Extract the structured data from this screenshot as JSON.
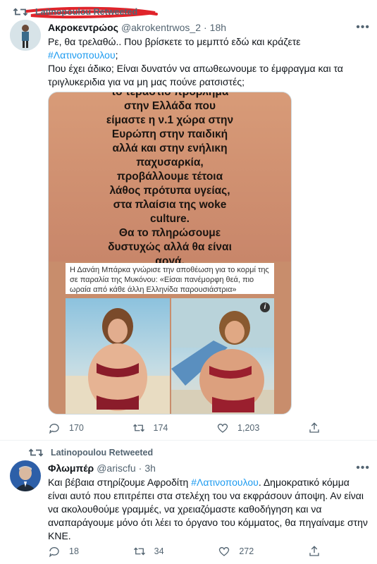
{
  "tweet1": {
    "retweeted_by": "Latinopoulou Retweeted",
    "author_name": "Ακροκεντρώος",
    "author_handle": "@akrokentrwos_2",
    "separator": "·",
    "time": "18h",
    "text_before_tag": "Ρε, θα τρελαθώ.. Που βρίσκετε το μεμπτό εδώ και κράζετε ",
    "hashtag": "#Λατινοπουλου",
    "text_after_tag": ";",
    "text_line2": "Που έχει άδικο; Είναι δυνατόν να απωθεωνουμε το έμφραγμα και τα τριγλυκεριδια για να μη μας πούνε ρατσιστές;",
    "media": {
      "overlay_text": "το τεράστιο πρόβλημα\nστην Ελλάδα που\nείμαστε η ν.1 χώρα στην\nΕυρώπη στην παιδική\nαλλά και στην ενήλικη\nπαχυσαρκία,\nπροβάλλουμε τέτοια\nλάθος πρότυπα υγείας,\nστα πλαίσια της woke\nculture.\nΘα το πληρώσουμε\nδυστυχώς αλλά θα είναι\nαργά.",
      "caption": "Η Δανάη Μπάρκα γνώρισε την αποθέωση για το κορμί της σε παραλία της Μυκόνου: «Είσαι πανέμορφη θεά, πιο ωραία από κάθε άλλη Ελληνίδα παρουσιάστρια»",
      "info_icon": "i"
    },
    "replies": "170",
    "retweets": "174",
    "likes": "1,203"
  },
  "tweet2": {
    "retweeted_by": "Latinopoulou Retweeted",
    "author_name": "Φλωμπέρ",
    "author_handle": "@ariscfu",
    "separator": "·",
    "time": "3h",
    "text_before_tag": "Και βέβαια στηρίζουμε Αφροδίτη ",
    "hashtag": "#Λατινοπουλου",
    "text_after_tag": ". Δημοκρατικό κόμμα είναι αυτό που επιτρέπει στα στελέχη του να εκφράσουν άποψη. Αν είναι να ακολουθούμε γραμμές, να χρειαζόμαστε καθοδήγηση και να αναπαράγουμε μόνο ότι λέει το όργανο του κόμματος, θα πηγαίναμε στην ΚΝΕ.",
    "replies": "18",
    "retweets": "34",
    "likes": "272"
  },
  "colors": {
    "accent": "#1d9bf0",
    "secondary": "#536471",
    "highlight": "#e0242b"
  },
  "icons": [
    "retweet-icon",
    "more-icon",
    "reply-icon",
    "like-icon",
    "share-icon",
    "info-icon"
  ]
}
